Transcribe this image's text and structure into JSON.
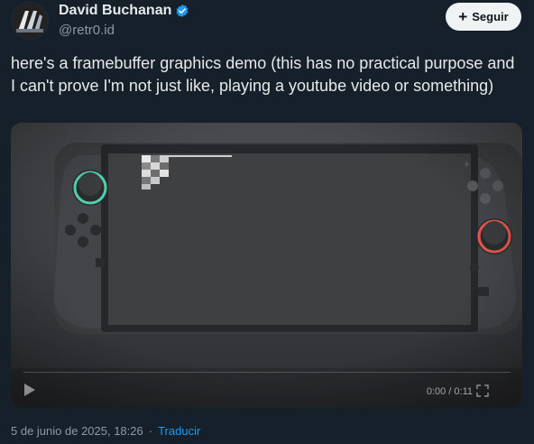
{
  "author": {
    "name": "David Buchanan",
    "handle": "@retr0.id",
    "verified_icon": "verified-badge-icon",
    "badge_color": "#1d9bf0"
  },
  "follow_button": {
    "label": "Seguir",
    "icon": "plus-icon"
  },
  "tweet": {
    "text": "here's a framebuffer graphics demo (this has no practical purpose and I can't prove I'm not just like, playing a youtube video or something)"
  },
  "video": {
    "time": "0:00 / 0:11",
    "play_icon": "play-icon",
    "fullscreen_icon": "fullscreen-icon"
  },
  "meta": {
    "date": "5 de junio de 2025, 18:26",
    "separator": "·",
    "translate_label": "Traducir"
  },
  "colors": {
    "background": "#15202b",
    "accent": "#1d9bf0",
    "secondary_text": "#8b98a5"
  }
}
